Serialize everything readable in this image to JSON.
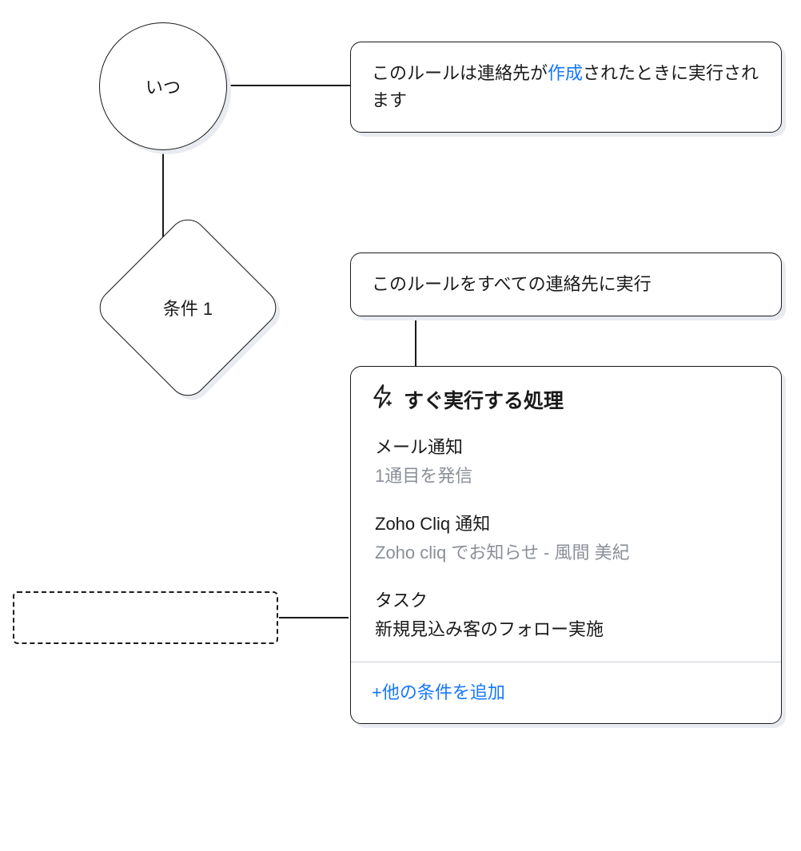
{
  "when_node": {
    "label": "いつ"
  },
  "when_card": {
    "prefix": "このルールは連絡先が",
    "link": "作成",
    "suffix": "されたときに実行されます"
  },
  "condition_node": {
    "label": "条件 1"
  },
  "condition_card": {
    "text": "このルールをすべての連絡先に実行"
  },
  "actions_panel": {
    "header": "すぐ実行する処理",
    "items": [
      {
        "title": "メール通知",
        "sub": "1通目を発信",
        "sub_muted": true
      },
      {
        "title": "Zoho Cliq 通知",
        "sub": "Zoho cliq でお知らせ - 風間 美紀",
        "sub_muted": true
      },
      {
        "title": "タスク",
        "sub": "新規見込み客のフォロー実施",
        "sub_muted": false
      }
    ],
    "footer_link": "+他の条件を追加"
  }
}
